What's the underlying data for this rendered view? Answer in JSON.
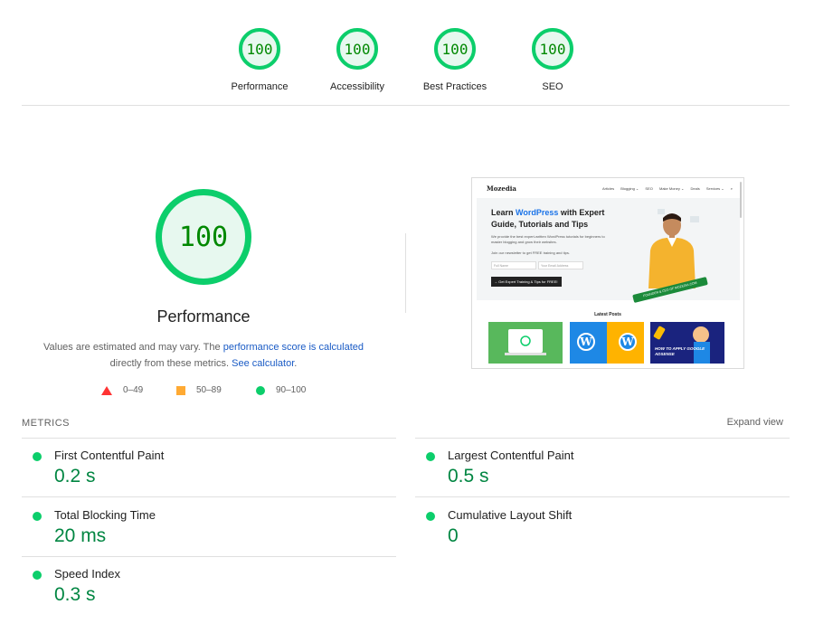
{
  "categories": [
    {
      "score": "100",
      "label": "Performance"
    },
    {
      "score": "100",
      "label": "Accessibility"
    },
    {
      "score": "100",
      "label": "Best Practices"
    },
    {
      "score": "100",
      "label": "SEO"
    }
  ],
  "main": {
    "score": "100",
    "title": "Performance",
    "desc_prefix": "Values are estimated and may vary. The ",
    "desc_link1": "performance score is calculated",
    "desc_mid": "directly from these metrics. ",
    "desc_link2": "See calculator",
    "desc_suffix": "."
  },
  "legend": [
    {
      "range": "0–49",
      "color": "#ff3333"
    },
    {
      "range": "50–89",
      "color": "#ffaa33"
    },
    {
      "range": "90–100",
      "color": "#0cce6b"
    }
  ],
  "screenshot": {
    "logo": "Mozedia",
    "nav": [
      "Articles",
      "Blogging ⌄",
      "SEO",
      "Make Money ⌄",
      "Deals",
      "Services ⌄",
      "⌕"
    ],
    "headline_pre": "Learn ",
    "headline_brand": "WordPress",
    "headline_post": " with Expert Guide, Tutorials and Tips",
    "para": "We provide the best expert-written WordPress tutorials for beginners to master blogging and grow their websites.",
    "para2": "Join our newsletter to get FREE training and tips.",
    "input1": "Full Name",
    "input2": "Your Email Address",
    "button": "→ Get Expert Training & Tips for FREE!",
    "badge": "FOUNDER & CEO OF MOZEDIA.COM",
    "latest": "Latest Posts",
    "card3": "HOW TO APPLY GOOGLE ADSENSE"
  },
  "metrics": {
    "title": "METRICS",
    "expand": "Expand view",
    "items": [
      {
        "label": "First Contentful Paint",
        "value": "0.2 s"
      },
      {
        "label": "Largest Contentful Paint",
        "value": "0.5 s"
      },
      {
        "label": "Total Blocking Time",
        "value": "20 ms"
      },
      {
        "label": "Cumulative Layout Shift",
        "value": "0"
      },
      {
        "label": "Speed Index",
        "value": "0.3 s"
      }
    ]
  },
  "colors": {
    "pass": "#0cce6b",
    "pass_text": "#008800",
    "metric_value": "#018642",
    "link": "#1a5bc5"
  }
}
